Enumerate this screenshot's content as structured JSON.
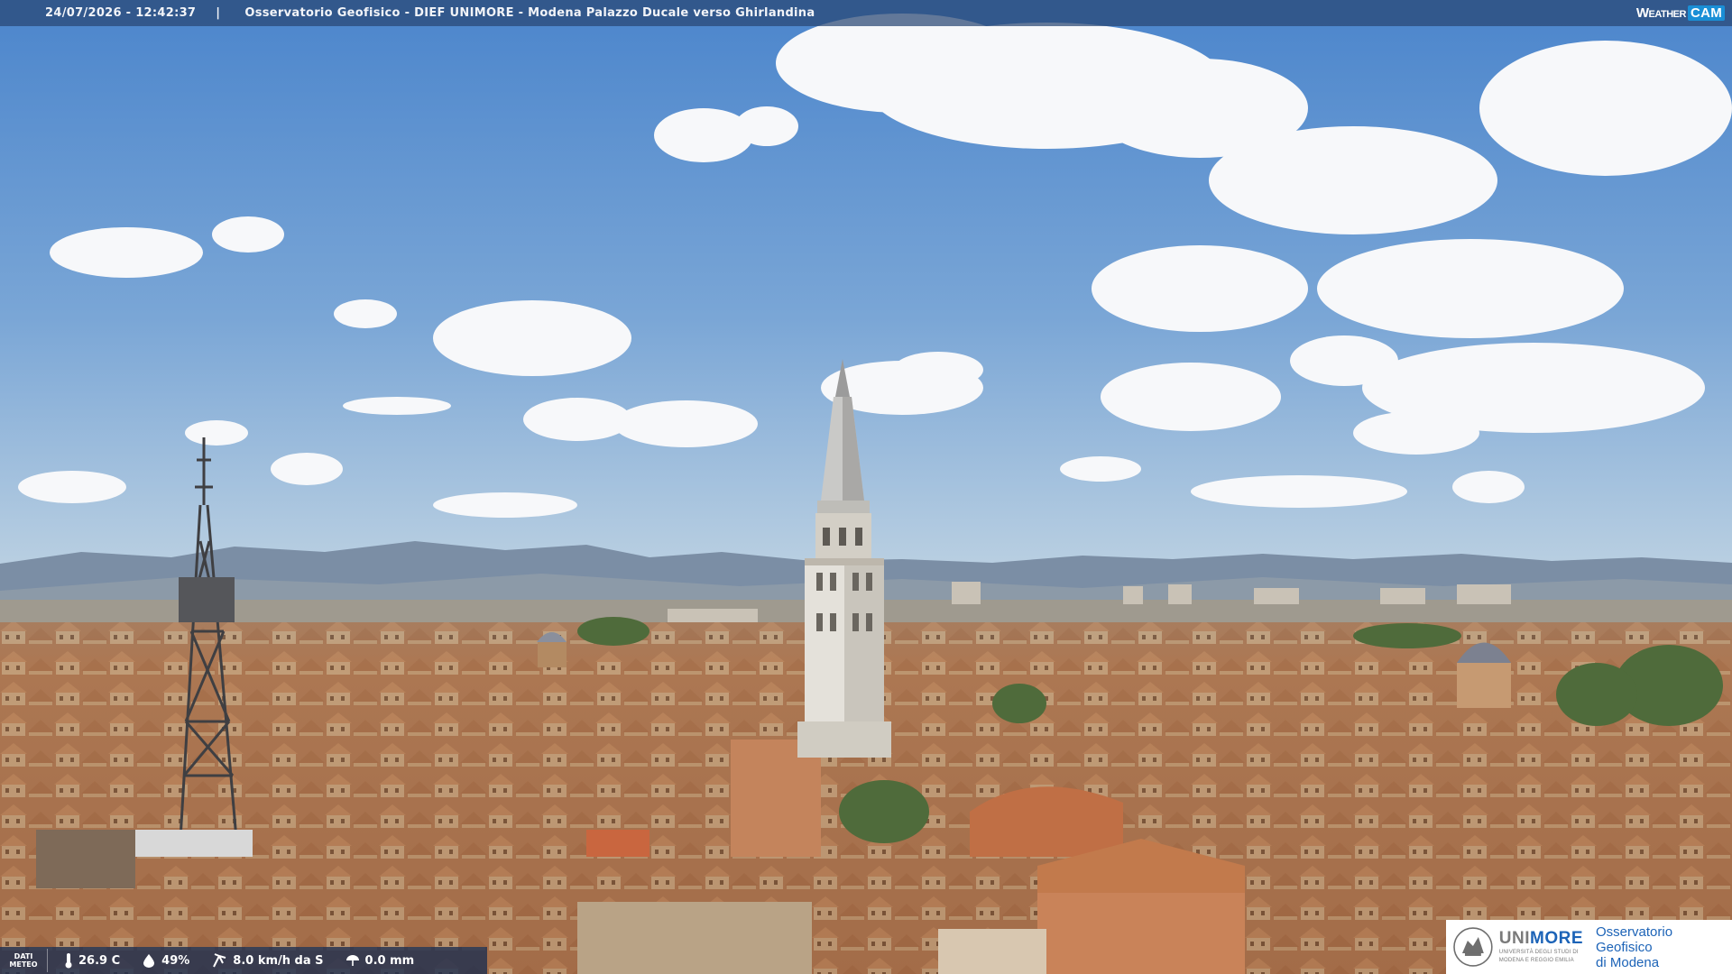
{
  "topbar": {
    "timestamp": "24/07/2026 - 12:42:37",
    "separator": "|",
    "camera_title": "Osservatorio Geofisico - DIEF UNIMORE - Modena Palazzo Ducale verso Ghirlandina",
    "brand_weather": "Weather",
    "brand_cam": "CAM"
  },
  "weather": {
    "label_line1": "DATI",
    "label_line2": "METEO",
    "temperature": "26.9 C",
    "humidity": "49%",
    "wind": "8.0 km/h da S",
    "rain": "0.0 mm"
  },
  "logo": {
    "uni_part1": "UNI",
    "uni_part2": "MORE",
    "uni_sub1": "UNIVERSITÀ DEGLI STUDI DI",
    "uni_sub2": "MODENA E REGGIO EMILIA",
    "obs_line1": "Osservatorio Geofisico",
    "obs_line2": "di Modena"
  },
  "icons": {
    "temperature": "thermometer-icon",
    "humidity": "droplet-icon",
    "wind": "wind-icon",
    "rain": "umbrella-icon"
  },
  "colors": {
    "sky_top": "#4c86cb",
    "sky_bottom": "#b9d0e4",
    "roofs": "#b47a52",
    "topbar_bg": "#284673",
    "logo_blue": "#1c63b7"
  }
}
